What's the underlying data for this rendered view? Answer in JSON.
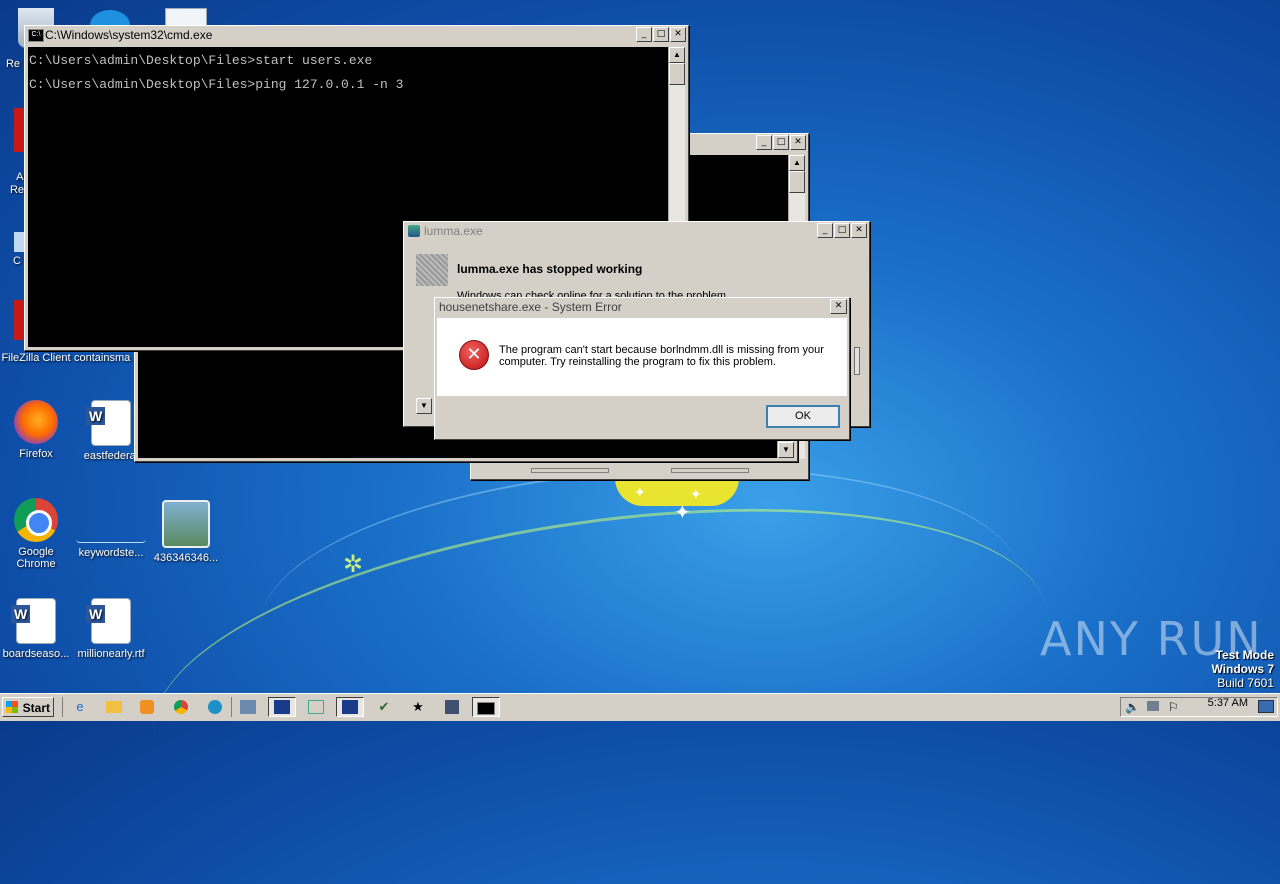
{
  "desktop": {
    "icons": [
      {
        "label": "Re"
      },
      {
        "label": "A\nRe"
      },
      {
        "label": "C"
      },
      {
        "label": "FileZilla Client"
      },
      {
        "label": "containsma"
      },
      {
        "label": "Firefox"
      },
      {
        "label": "eastfederal"
      },
      {
        "label": "Google Chrome"
      },
      {
        "label": "keywordste..."
      },
      {
        "label": "436346346..."
      },
      {
        "label": "boardseaso..."
      },
      {
        "label": "millionearly.rtf"
      }
    ],
    "watermark": {
      "brand": "ANY RUN",
      "mode_line1": "Test Mode",
      "mode_line2": "Windows 7",
      "mode_line3": "Build 7601"
    }
  },
  "cmd_window": {
    "title": "C:\\Windows\\system32\\cmd.exe",
    "lines": [
      "C:\\Users\\admin\\Desktop\\Files>start users.exe",
      "C:\\Users\\admin\\Desktop\\Files>ping 127.0.0.1 -n 3"
    ]
  },
  "lumma_dialog": {
    "title": "lumma.exe",
    "heading": "lumma.exe has stopped working",
    "body": "Windows can check online for a solution to the problem."
  },
  "error_dialog": {
    "title": "housenetshare.exe - System Error",
    "message": "The program can't start because borlndmm.dll is missing from your computer. Try reinstalling the program to fix this problem.",
    "ok_label": "OK"
  },
  "taskbar": {
    "start_label": "Start",
    "clock": "5:37 AM"
  },
  "glyphs": {
    "minimize": "_",
    "maximize": "□",
    "close": "✕",
    "up": "▲",
    "down": "▼"
  }
}
